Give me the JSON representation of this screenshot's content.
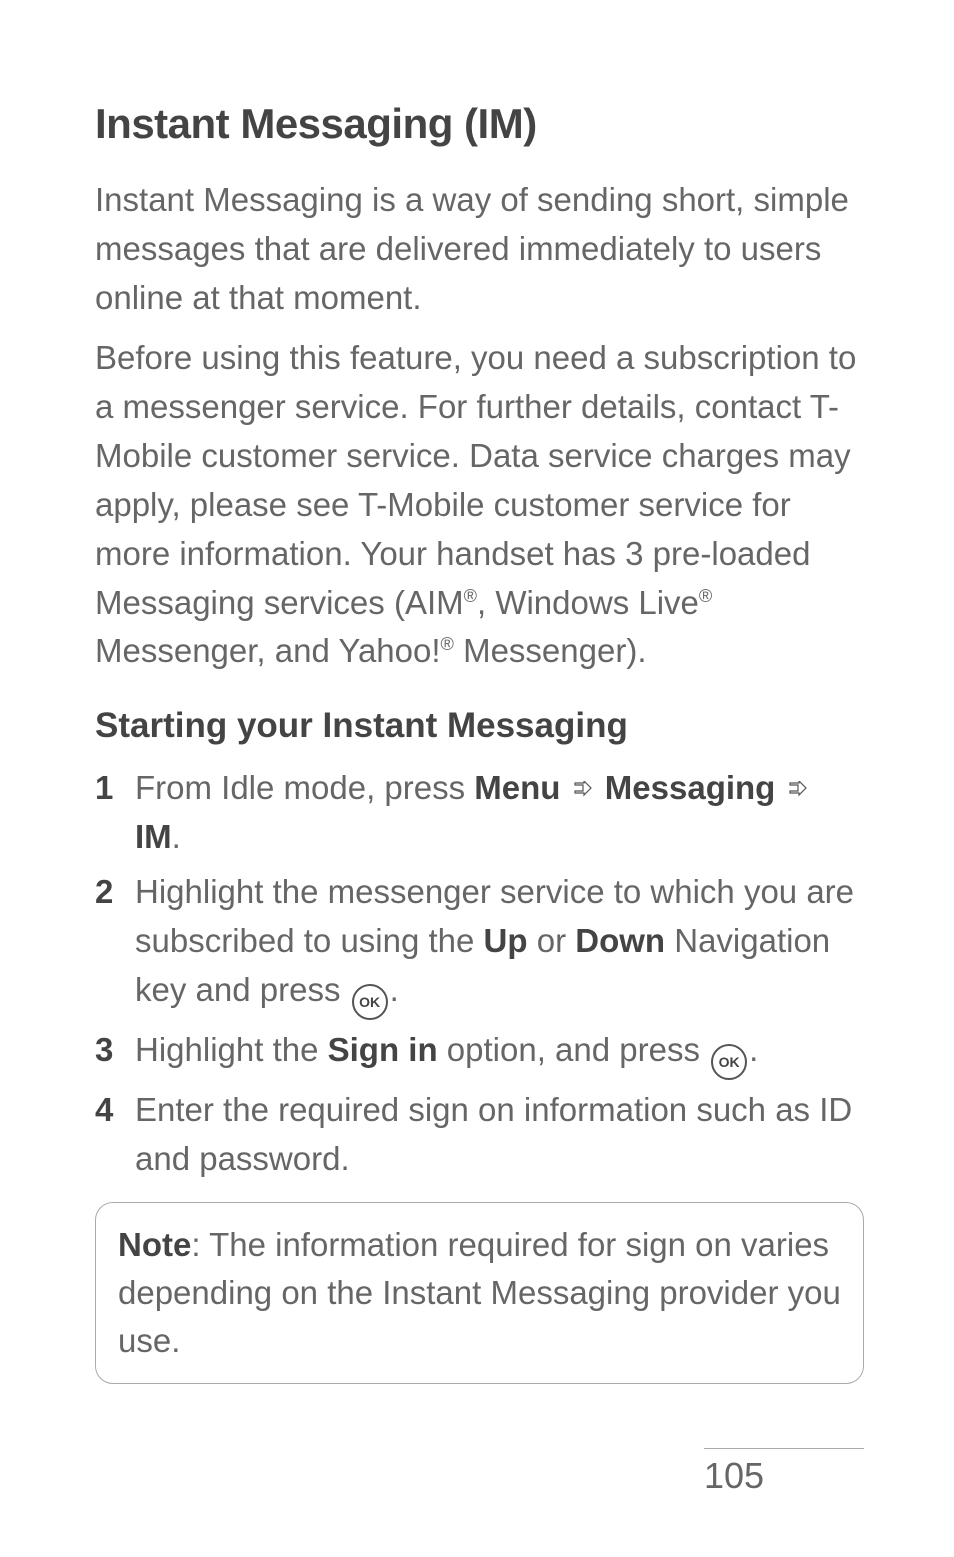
{
  "heading": "Instant Messaging (IM)",
  "intro1": "Instant Messaging is a way of sending short, simple messages that are delivered immediately to users online at that moment.",
  "intro2_pre": "Before using this feature, you need a subscription to a messenger service. For further details, contact T-Mobile customer service. Data service charges may apply, please see T-Mobile customer service for more information. Your handset has 3 pre-loaded Messaging services (AIM",
  "intro2_mid": ", Windows Live",
  "intro2_post": " Messenger, and Yahoo!",
  "intro2_end": " Messenger).",
  "subheading": "Starting your Instant Messaging",
  "steps": {
    "s1": {
      "t1": "From Idle mode, press ",
      "menu": "Menu",
      "messaging": "Messaging",
      "im": "IM",
      "period": "."
    },
    "s2": {
      "t1": "Highlight the messenger service to which you are subscribed to using the ",
      "up": "Up",
      "or": " or ",
      "down": "Down",
      "t2": " Navigation key and press ",
      "period": "."
    },
    "s3": {
      "t1": "Highlight the ",
      "signin": "Sign in",
      "t2": " option, and press ",
      "period": "."
    },
    "s4": "Enter the required sign on information such as ID and password."
  },
  "note_label": "Note",
  "note_text": ": The information required for sign on varies depending on the Instant Messaging provider you use.",
  "ok_label": "OK",
  "registered": "®",
  "page_number": "105"
}
